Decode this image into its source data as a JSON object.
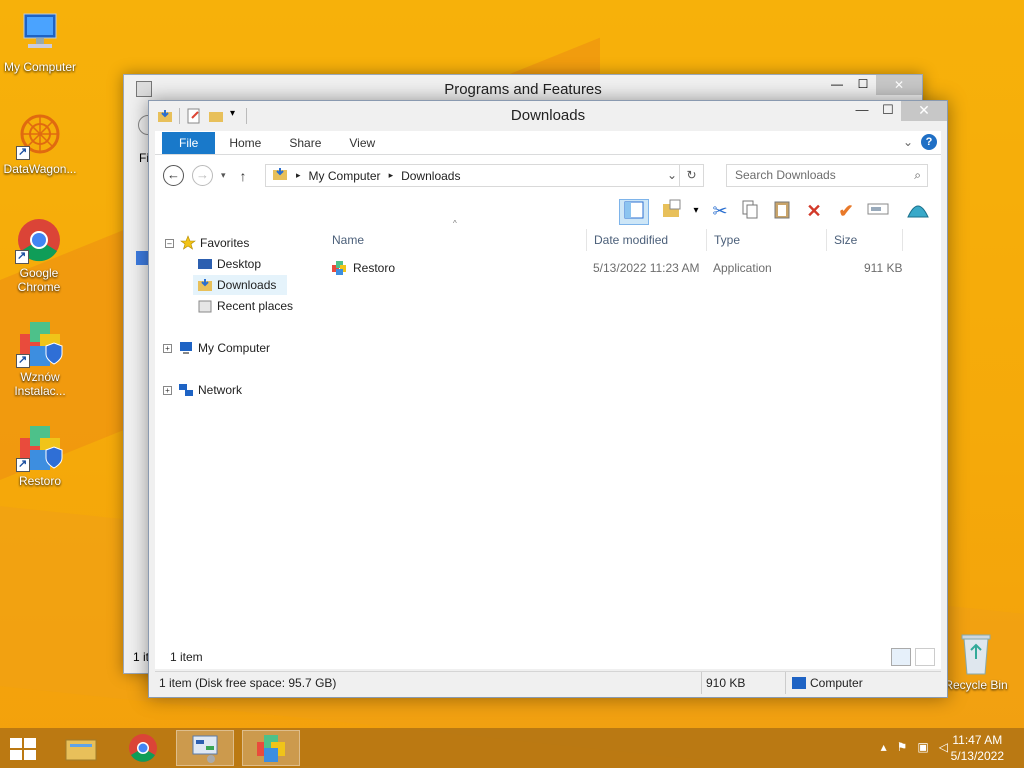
{
  "desktop": {
    "icons": [
      {
        "label": "My Computer",
        "icon": "computer-icon"
      },
      {
        "label": "DataWagon...",
        "icon": "datawagon-icon"
      },
      {
        "label": "Google Chrome",
        "icon": "chrome-icon"
      },
      {
        "label": "Wznów Instalac...",
        "icon": "restoro-installer-icon"
      },
      {
        "label": "Restoro",
        "icon": "restoro-icon"
      }
    ],
    "recycle_bin_label": "Recycle Bin"
  },
  "back_window": {
    "title": "Programs and Features",
    "left_char_1": "Fi",
    "left_char_2": "1 it"
  },
  "window": {
    "title": "Downloads",
    "controls": {
      "minimize": "—",
      "maximize": "☐",
      "close": "✕"
    },
    "ribbon_tabs": [
      "File",
      "Home",
      "Share",
      "View"
    ],
    "address": {
      "crumbs": [
        "My Computer",
        "Downloads"
      ],
      "separator": "▸"
    },
    "search_placeholder": "Search Downloads",
    "nav_pane": {
      "favorites": "Favorites",
      "favorites_items": [
        "Desktop",
        "Downloads",
        "Recent places"
      ],
      "my_computer": "My Computer",
      "network": "Network"
    },
    "columns": [
      "Name",
      "Date modified",
      "Type",
      "Size"
    ],
    "files": [
      {
        "name": "Restoro",
        "date_modified": "5/13/2022 11:23 AM",
        "type": "Application",
        "size": "911 KB"
      }
    ],
    "item_count": "1 item",
    "status": {
      "disk": "1 item (Disk free space: 95.7 GB)",
      "size": "910 KB",
      "location": "Computer"
    }
  },
  "taskbar": {
    "clock_time": "11:47 AM",
    "clock_date": "5/13/2022"
  },
  "colors": {
    "desktop": "#f5a90a",
    "file_tab": "#1979ca",
    "selection": "#e5f3fb"
  }
}
